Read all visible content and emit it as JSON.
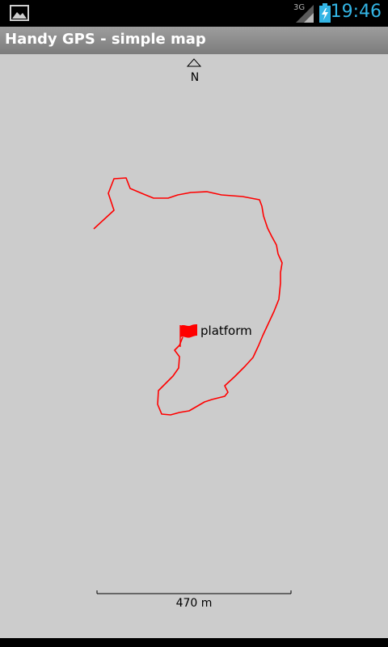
{
  "status_bar": {
    "network_type": "3G",
    "clock": "19:46",
    "clock_color": "#33b5e5",
    "icons": [
      "gallery-icon",
      "signal-icon",
      "battery-charging-icon"
    ]
  },
  "app": {
    "title": "Handy GPS - simple map"
  },
  "map": {
    "background_color": "#cccccc",
    "track_color": "#ff0000",
    "compass_label": "N",
    "waypoint": {
      "label": "platform",
      "icon": "flag-icon",
      "color": "#ff0000"
    },
    "scale": {
      "label": "470 m"
    }
  }
}
